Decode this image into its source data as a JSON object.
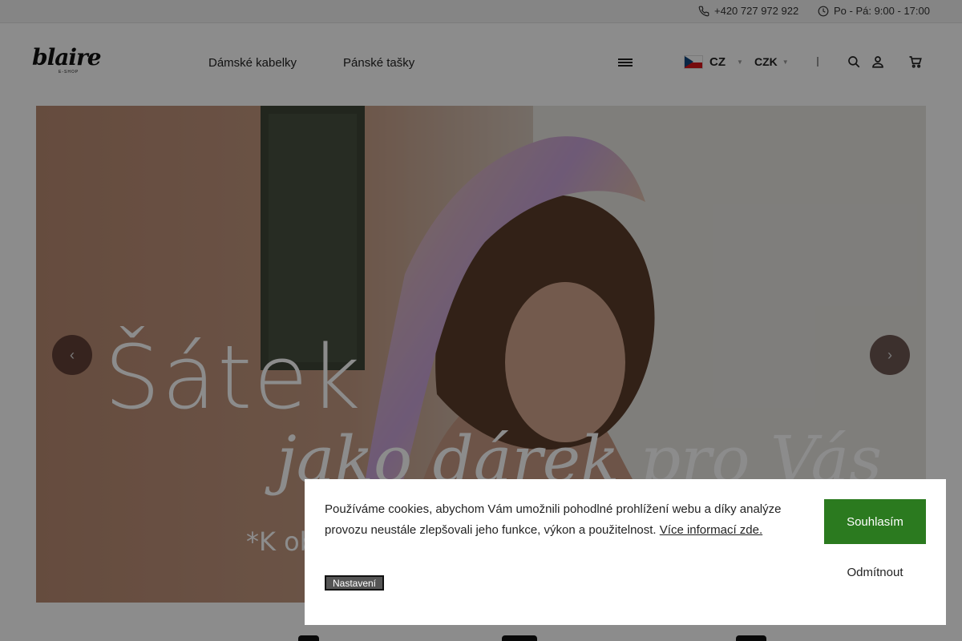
{
  "topbar": {
    "phone": "+420 727 972 922",
    "hours": "Po - Pá: 9:00 - 17:00",
    "phone_icon": "phone-icon",
    "clock_icon": "clock-icon"
  },
  "header": {
    "logo_text": "blaire",
    "logo_sub": "E-SHOP",
    "nav": [
      "Dámské kabelky",
      "Pánské tašky"
    ],
    "language": "CZ",
    "currency": "CZK",
    "icons": [
      "menu-icon",
      "flag-cz-icon",
      "search-icon",
      "user-icon",
      "cart-icon"
    ]
  },
  "hero": {
    "headline": "Šátek",
    "subheadline": "jako dárek pro Vás",
    "note": "*K ob",
    "prev_icon": "chevron-left-icon",
    "next_icon": "chevron-right-icon"
  },
  "cookie": {
    "text": "Používáme cookies, abychom Vám umožnili pohodlné prohlížení webu a díky analýze provozu neustále zlepšovali jeho funkce, výkon a použitelnost.",
    "more_link": "Více informací zde.",
    "settings_label": "Nastavení",
    "accept_label": "Souhlasím",
    "reject_label": "Odmítnout"
  },
  "colors": {
    "accept_button": "#2b7a1f",
    "topbar_bg": "#f3f3f3",
    "flag_blue": "#11457e",
    "flag_red": "#d7141a"
  }
}
